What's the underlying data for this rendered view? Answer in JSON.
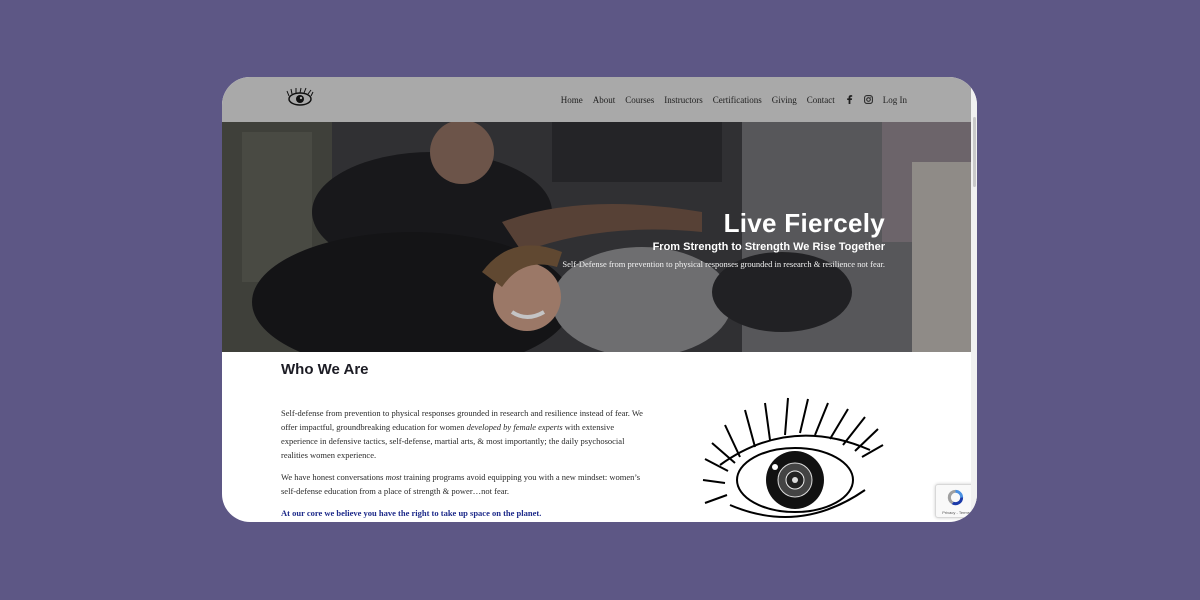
{
  "nav": {
    "items": [
      "Home",
      "About",
      "Courses",
      "Instructors",
      "Certifications",
      "Giving",
      "Contact"
    ],
    "social": [
      "facebook-icon",
      "instagram-icon"
    ],
    "login": "Log In"
  },
  "hero": {
    "title": "Live Fiercely",
    "subtitle": "From Strength to Strength We Rise Together",
    "description": "Self-Defense from prevention to physical responses grounded in research & resilience not fear."
  },
  "about": {
    "title": "Who We Are",
    "p1_a": "Self-defense from prevention to physical responses grounded in research and resilience instead of fear. We offer impactful, groundbreaking education for women ",
    "p1_em": "developed by female experts",
    "p1_b": " with extensive experience in defensive tactics, self-defense, martial arts, & most importantly; the daily psychosocial realities women experience.",
    "p2_a": "We have honest conversations ",
    "p2_em": "most",
    "p2_b": " training programs avoid equipping you with a new mindset: women’s self-defense education from a place of strength & power…not fear.",
    "p3": "At our core we believe you have the right to take up space on the planet."
  },
  "recaptcha": {
    "footer": "Privacy - Terms"
  },
  "colors": {
    "background": "#5d5785",
    "header": "#a9a9a9",
    "accent_text": "#1d2a8a"
  }
}
